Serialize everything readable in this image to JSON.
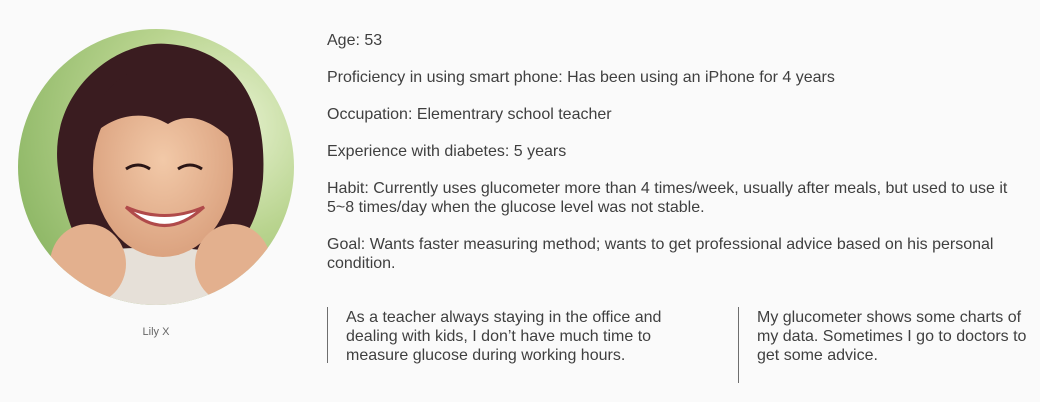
{
  "persona": {
    "name": "Lily X",
    "avatar_icon": "persona-portrait"
  },
  "profile": {
    "age": "Age: 53",
    "proficiency": "Proficiency in using smart phone: Has been using an iPhone for 4 years",
    "occupation": "Occupation: Elementrary school teacher",
    "experience": "Experience with diabetes: 5 years",
    "habit": "Habit: Currently uses glucometer more than 4 times/week, usually after meals, but used to use it 5~8 times/day when the glucose level was not stable.",
    "goal": "Goal: Wants faster measuring method; wants to get professional advice based on his personal condition."
  },
  "quotes": [
    "As a teacher always staying in the office and dealing with kids, I don’t have much time to measure glucose during working hours.",
    "My glucometer shows some charts of my data. Sometimes I go to doctors to get some advice."
  ],
  "colors": {
    "background": "#fafafa",
    "text": "#3f3f3f",
    "divider": "#6e6e6e"
  }
}
